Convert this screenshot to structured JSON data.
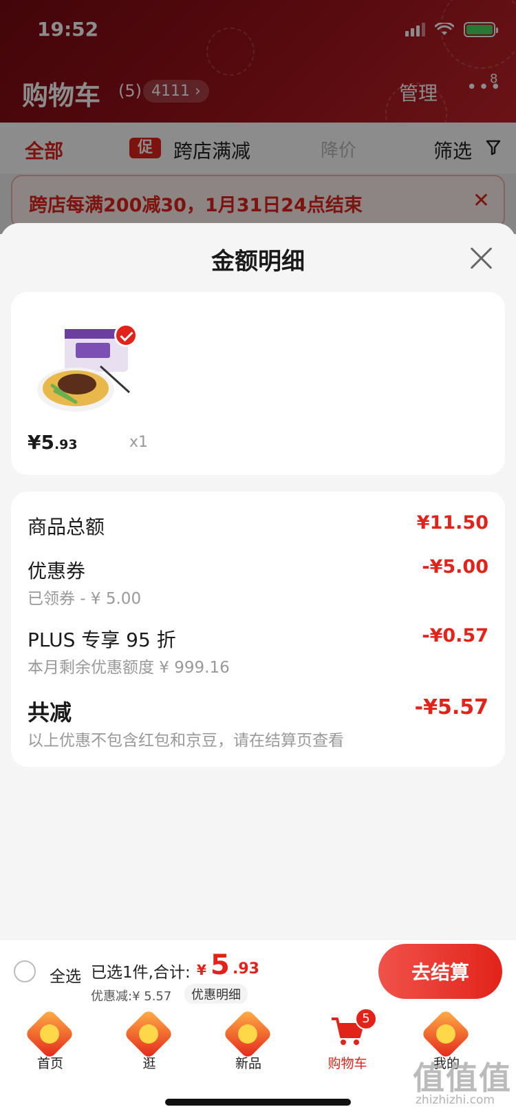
{
  "status_bar": {
    "time": "19:52"
  },
  "header": {
    "title": "购物车",
    "count": "(5)",
    "address": "4111 ›",
    "manage": "管理",
    "more": "•••",
    "more_badge": "8"
  },
  "filter_bar": {
    "all": "全部",
    "promo_icon": "促",
    "cross_store": "跨店满减",
    "price_drop": "降价",
    "screen": "筛选"
  },
  "promo_banner": {
    "text": "跨店每满200减30，1月31日24点结束",
    "close": "✕"
  },
  "sheet": {
    "title": "金额明细",
    "goods": {
      "price_symbol_main": "¥5",
      "price_decimal": ".93",
      "qty": "x1"
    },
    "rows": {
      "total_label": "商品总额",
      "total_amount": "¥11.50",
      "coupon_label": "优惠券",
      "coupon_amount": "-¥5.00",
      "coupon_sub": "已领券 - ¥ 5.00",
      "plus_label": "PLUS 专享 95 折",
      "plus_amount": "-¥0.57",
      "plus_sub": "本月剩余优惠额度 ¥ 999.16",
      "reduce_label": "共减",
      "reduce_amount": "-¥5.57",
      "reduce_note": "以上优惠不包含红包和京豆，请在结算页查看"
    }
  },
  "checkout": {
    "select_all": "全选",
    "selected": "已选1件,合计:",
    "yuan": "¥",
    "amount_int": "5",
    "amount_dec": ".93",
    "discount": "优惠减:¥ 5.57",
    "detail_link": "优惠明细",
    "pay_button": "去结算"
  },
  "tabs": [
    {
      "label": "首页"
    },
    {
      "label": "逛"
    },
    {
      "label": "新品"
    },
    {
      "label": "购物车",
      "badge": "5"
    },
    {
      "label": "我的"
    }
  ],
  "watermark": {
    "brand": "值值值",
    "url": "zhizhizhi.com"
  },
  "colors": {
    "accent": "#e2231a",
    "header_bg": "#a0141c"
  },
  "icons": [
    "signal-icon",
    "wifi-icon",
    "battery-icon",
    "filter-icon",
    "close-icon",
    "check-icon",
    "cart-icon"
  ]
}
